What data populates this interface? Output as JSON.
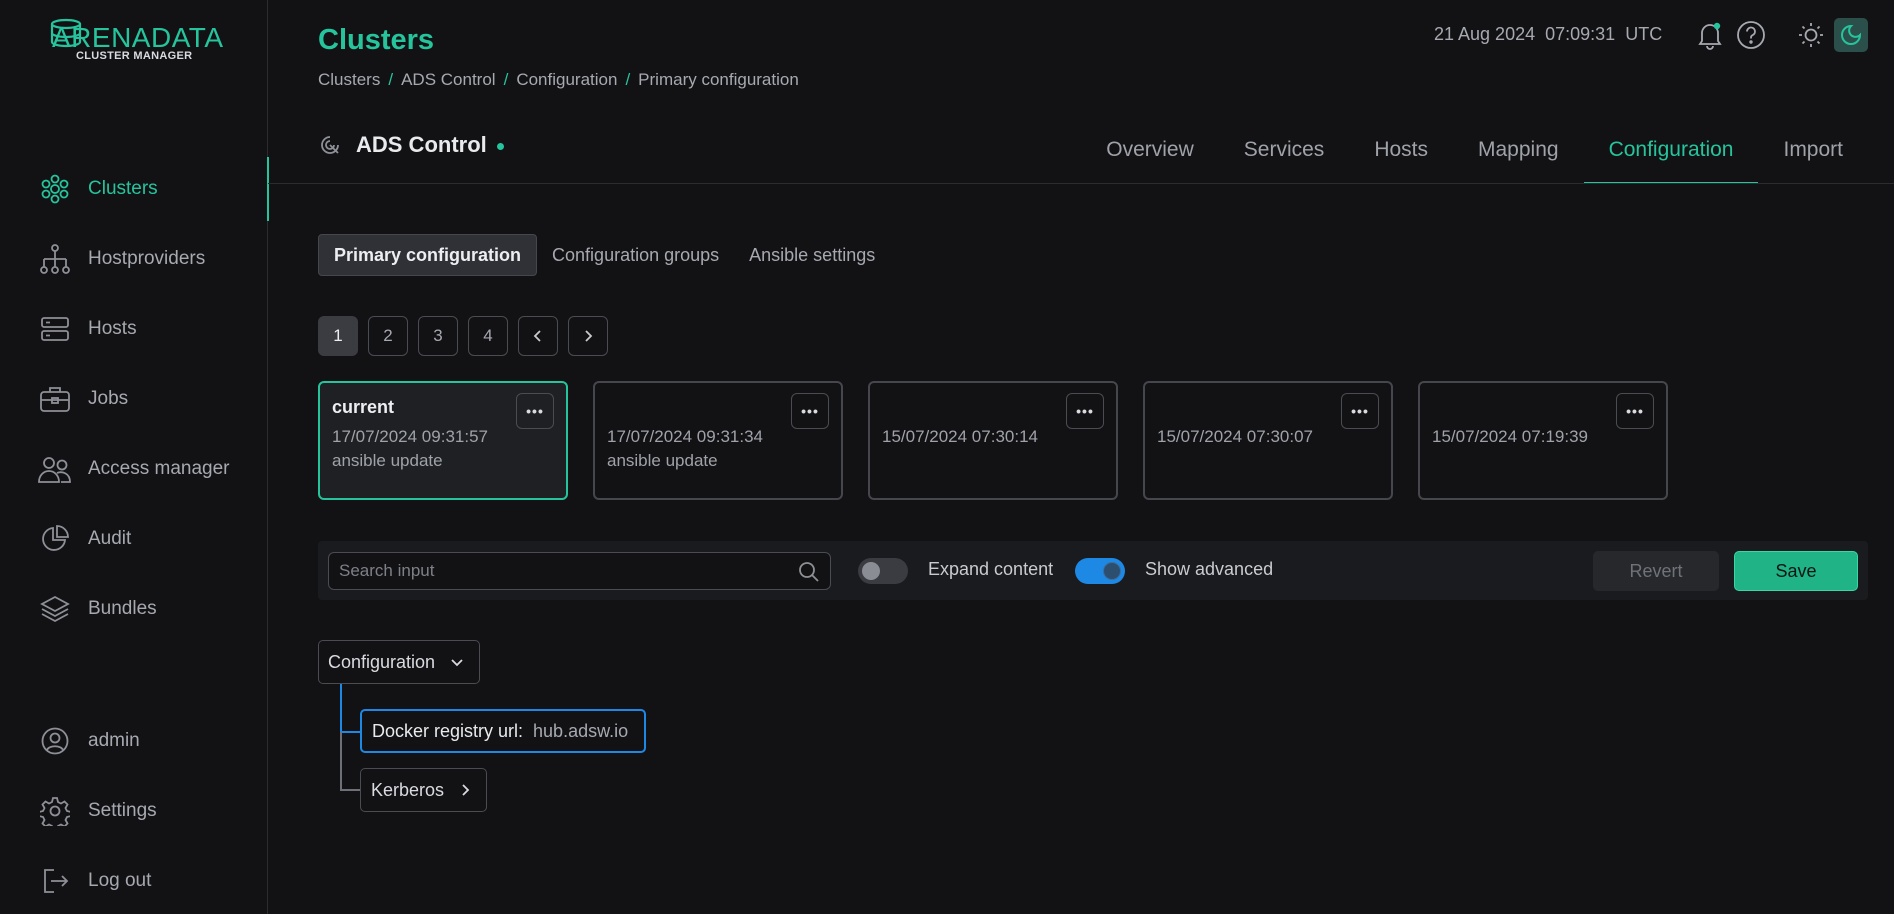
{
  "app": {
    "logo_main": "ARENADATA",
    "logo_sub": "CLUSTER MANAGER",
    "accent": "#26c49d"
  },
  "sidebar": {
    "items": [
      {
        "label": "Clusters",
        "icon": "clusters-icon",
        "active": true
      },
      {
        "label": "Hostproviders",
        "icon": "hostproviders-icon"
      },
      {
        "label": "Hosts",
        "icon": "hosts-icon"
      },
      {
        "label": "Jobs",
        "icon": "jobs-icon"
      },
      {
        "label": "Access manager",
        "icon": "access-manager-icon"
      },
      {
        "label": "Audit",
        "icon": "audit-icon"
      },
      {
        "label": "Bundles",
        "icon": "bundles-icon"
      }
    ],
    "bottom_items": [
      {
        "label": "admin",
        "icon": "user-icon"
      },
      {
        "label": "Settings",
        "icon": "gear-icon"
      },
      {
        "label": "Log out",
        "icon": "logout-icon"
      }
    ]
  },
  "header": {
    "title": "Clusters",
    "breadcrumb": [
      "Clusters",
      "ADS Control",
      "Configuration",
      "Primary configuration"
    ],
    "date": "21 Aug 2024",
    "time": "07:09:31",
    "timezone": "UTC"
  },
  "cluster": {
    "name": "ADS Control",
    "status_color": "#26c49d",
    "tabs": [
      "Overview",
      "Services",
      "Hosts",
      "Mapping",
      "Configuration",
      "Import"
    ],
    "active_tab": "Configuration"
  },
  "subtabs": {
    "items": [
      "Primary configuration",
      "Configuration groups",
      "Ansible settings"
    ],
    "active": "Primary configuration"
  },
  "pagination": {
    "pages": [
      "1",
      "2",
      "3",
      "4"
    ],
    "current": "1"
  },
  "versions": [
    {
      "title": "current",
      "date": "17/07/2024 09:31:57",
      "description": "ansible update",
      "active": true
    },
    {
      "title": "",
      "date": "17/07/2024 09:31:34",
      "description": "ansible update"
    },
    {
      "title": "",
      "date": "15/07/2024 07:30:14",
      "description": ""
    },
    {
      "title": "",
      "date": "15/07/2024 07:30:07",
      "description": ""
    },
    {
      "title": "",
      "date": "15/07/2024 07:19:39",
      "description": ""
    }
  ],
  "toolbar": {
    "search_placeholder": "Search input",
    "expand_label": "Expand content",
    "expand_on": false,
    "advanced_label": "Show advanced",
    "advanced_on": true,
    "revert_label": "Revert",
    "save_label": "Save"
  },
  "config_tree": {
    "root_label": "Configuration",
    "fields": [
      {
        "label": "Docker registry url:",
        "value": "hub.adsw.io"
      }
    ],
    "groups": [
      {
        "label": "Kerberos"
      }
    ]
  }
}
